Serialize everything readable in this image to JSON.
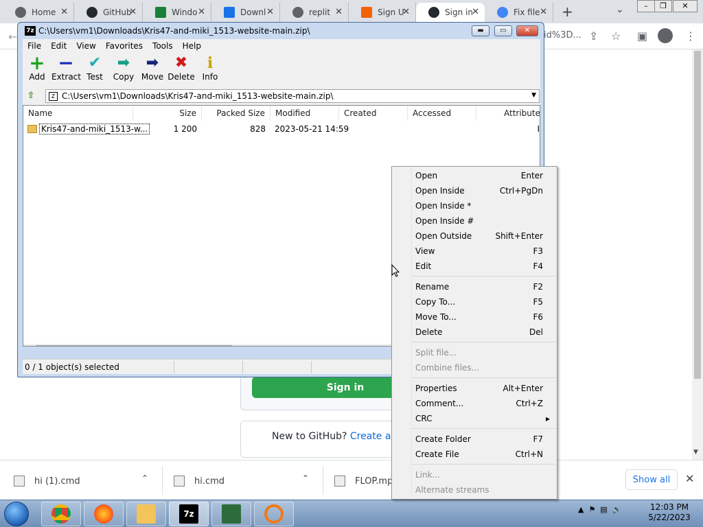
{
  "browser": {
    "tabs": [
      {
        "title": "Home",
        "icon": "globe-icon"
      },
      {
        "title": "GitHub",
        "icon": "github-icon"
      },
      {
        "title": "Windo",
        "icon": "sheet-icon"
      },
      {
        "title": "Downl",
        "icon": "download-icon"
      },
      {
        "title": "replit",
        "icon": "globe-icon"
      },
      {
        "title": "Sign U",
        "icon": "replit-icon"
      },
      {
        "title": "Sign in",
        "icon": "github-icon"
      },
      {
        "title": "Fix file",
        "icon": "google-icon"
      }
    ],
    "address_fragment": "id%3D..."
  },
  "page": {
    "signin_label": "Sign in",
    "new_to_github": "New to GitHub?",
    "create_account": "Create an ac"
  },
  "downloads": {
    "items": [
      "hi (1).cmd",
      "hi.cmd",
      "FLOP.mp4"
    ],
    "show_all": "Show all"
  },
  "taskbar": {
    "time": "12:03 PM",
    "date": "5/22/2023",
    "apps": [
      "chrome",
      "firefox",
      "explorer",
      "7zip",
      "task-manager",
      "search"
    ]
  },
  "zip": {
    "title": "C:\\Users\\vm1\\Downloads\\Kris47-and-miki_1513-website-main.zip\\",
    "icon_text": "7z",
    "menu": [
      "File",
      "Edit",
      "View",
      "Favorites",
      "Tools",
      "Help"
    ],
    "toolbar": [
      {
        "label": "Add",
        "icon": "plus-icon",
        "color": "#1fa51f"
      },
      {
        "label": "Extract",
        "icon": "minus-icon",
        "color": "#1b2fb5"
      },
      {
        "label": "Test",
        "icon": "check-icon",
        "color": "#1ab0b0"
      },
      {
        "label": "Copy",
        "icon": "arrow-right-icon",
        "color": "#1aa08a"
      },
      {
        "label": "Move",
        "icon": "arrow-right-icon",
        "color": "#17247a"
      },
      {
        "label": "Delete",
        "icon": "x-icon",
        "color": "#d11a1a"
      },
      {
        "label": "Info",
        "icon": "info-icon",
        "color": "#c9a400"
      }
    ],
    "address": "C:\\Users\\vm1\\Downloads\\Kris47-and-miki_1513-website-main.zip\\",
    "columns": [
      "Name",
      "Size",
      "Packed Size",
      "Modified",
      "Created",
      "Accessed",
      "Attribute"
    ],
    "rows": [
      {
        "name": "Kris47-and-miki_1513-w...",
        "size": "1 200",
        "packed": "828",
        "modified": "2023-05-21 14:59",
        "attr": "I"
      }
    ],
    "status": "0 / 1 object(s) selected"
  },
  "context_menu": {
    "groups": [
      [
        {
          "label": "Open",
          "key": "Enter"
        },
        {
          "label": "Open Inside",
          "key": "Ctrl+PgDn"
        },
        {
          "label": "Open Inside *",
          "key": ""
        },
        {
          "label": "Open Inside #",
          "key": ""
        },
        {
          "label": "Open Outside",
          "key": "Shift+Enter"
        },
        {
          "label": "View",
          "key": "F3"
        },
        {
          "label": "Edit",
          "key": "F4"
        }
      ],
      [
        {
          "label": "Rename",
          "key": "F2"
        },
        {
          "label": "Copy To...",
          "key": "F5"
        },
        {
          "label": "Move To...",
          "key": "F6"
        },
        {
          "label": "Delete",
          "key": "Del"
        }
      ],
      [
        {
          "label": "Split file...",
          "key": "",
          "disabled": true
        },
        {
          "label": "Combine files...",
          "key": "",
          "disabled": true
        }
      ],
      [
        {
          "label": "Properties",
          "key": "Alt+Enter"
        },
        {
          "label": "Comment...",
          "key": "Ctrl+Z"
        },
        {
          "label": "CRC",
          "key": "▸"
        }
      ],
      [
        {
          "label": "Create Folder",
          "key": "F7"
        },
        {
          "label": "Create File",
          "key": "Ctrl+N"
        }
      ],
      [
        {
          "label": "Link...",
          "key": "",
          "disabled": true
        },
        {
          "label": "Alternate streams",
          "key": "",
          "disabled": true
        }
      ]
    ]
  }
}
